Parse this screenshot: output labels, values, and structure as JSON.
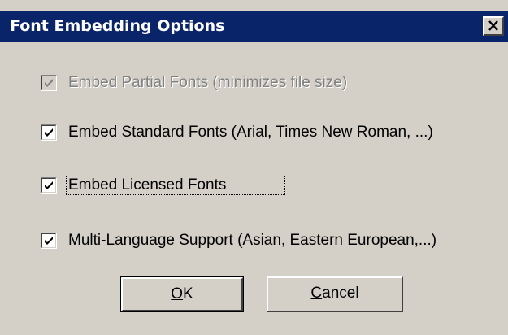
{
  "window": {
    "title": "Font Embedding Options",
    "close_icon": "close-x-icon",
    "title_bar_color": "#0a246a",
    "face_color": "#d4d0c8"
  },
  "options": [
    {
      "label": "Embed Partial Fonts  (minimizes file size)",
      "checked": true,
      "enabled": false
    },
    {
      "label": "Embed Standard Fonts (Arial, Times New Roman, ...)",
      "checked": true,
      "enabled": true
    },
    {
      "label": "Embed Licensed Fonts",
      "checked": true,
      "enabled": true,
      "focused": true
    },
    {
      "label": "Multi-Language Support (Asian, Eastern European,...)",
      "checked": true,
      "enabled": true
    }
  ],
  "buttons": {
    "ok": {
      "mnemonic": "O",
      "rest": "K",
      "default": true
    },
    "cancel": {
      "mnemonic": "C",
      "rest": "ancel"
    }
  },
  "icons": {
    "checkmark": "checkmark-icon"
  }
}
